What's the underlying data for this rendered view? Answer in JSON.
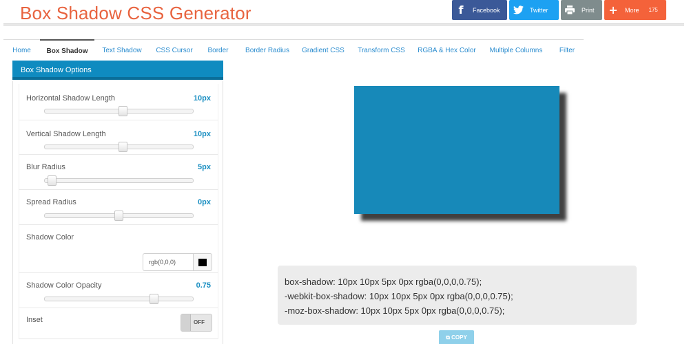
{
  "header": {
    "title": "Box Shadow CSS Generator",
    "share": [
      {
        "label": "Facebook",
        "icon": "facebook-icon",
        "color": "#3b5998"
      },
      {
        "label": "Twitter",
        "icon": "twitter-icon",
        "color": "#1da1f2"
      },
      {
        "label": "Print",
        "icon": "print-icon",
        "color": "#7f8c8d"
      },
      {
        "label": "More",
        "icon": "plus-icon",
        "color": "#f4623a",
        "count": "175"
      }
    ]
  },
  "tabs": [
    {
      "label": "Home"
    },
    {
      "label": "Box Shadow",
      "active": true
    },
    {
      "label": "Text Shadow"
    },
    {
      "label": "CSS Cursor"
    },
    {
      "label": "Border"
    },
    {
      "label": "Border Radius"
    },
    {
      "label": "Gradient CSS"
    },
    {
      "label": "Transform CSS"
    },
    {
      "label": "RGBA & Hex Color"
    },
    {
      "label": "Multiple Columns"
    },
    {
      "label": "Filter"
    }
  ],
  "options_panel": {
    "title": "Box Shadow Options",
    "horizontal": {
      "label": "Horizontal Shadow Length",
      "value": "10px",
      "slider_fraction": 0.53
    },
    "vertical": {
      "label": "Vertical Shadow Length",
      "value": "10px",
      "slider_fraction": 0.53
    },
    "blur": {
      "label": "Blur Radius",
      "value": "5px",
      "slider_fraction": 0.02
    },
    "spread": {
      "label": "Spread Radius",
      "value": "0px",
      "slider_fraction": 0.5
    },
    "color": {
      "label": "Shadow Color",
      "value": "rgb(0,0,0)",
      "swatch": "#000000"
    },
    "opacity": {
      "label": "Shadow Color Opacity",
      "value": "0.75",
      "slider_fraction": 0.75
    },
    "inset": {
      "label": "Inset",
      "state": "OFF"
    }
  },
  "preview": {
    "box_color": "#1789b9"
  },
  "code": {
    "lines": [
      "box-shadow: 10px 10px 5px 0px rgba(0,0,0,0.75);",
      "-webkit-box-shadow: 10px 10px 5px 0px rgba(0,0,0,0.75);",
      "-moz-box-shadow: 10px 10px 5px 0px rgba(0,0,0,0.75);"
    ],
    "copy_label": "COPY"
  },
  "colors": {
    "title": "#e8633f",
    "accent": "#0f8bc0",
    "tab_link": "#2a8ccf"
  }
}
